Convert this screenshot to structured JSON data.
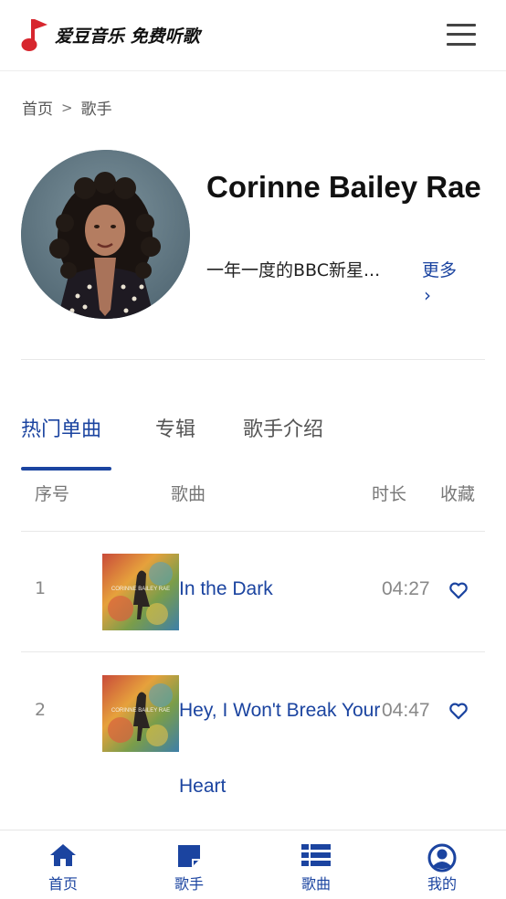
{
  "header": {
    "logo_text": "爱豆音乐 免费听歌",
    "menu_icon": "hamburger-menu-icon"
  },
  "breadcrumb": {
    "home": "首页",
    "current": "歌手"
  },
  "artist": {
    "name": "Corinne Bailey Rae",
    "description": "一年一度的BBC新星...",
    "more_label": "更多",
    "more_chevron": "›"
  },
  "tabs": [
    {
      "label": "热门单曲",
      "active": true
    },
    {
      "label": "专辑",
      "active": false
    },
    {
      "label": "歌手介绍",
      "active": false
    }
  ],
  "table": {
    "headers": {
      "index": "序号",
      "song": "歌曲",
      "duration": "时长",
      "favorite": "收藏"
    },
    "rows": [
      {
        "index": "1",
        "title": "In the Dark",
        "title_line2": "",
        "duration": "04:27",
        "favorite_icon": "heart-outline-icon"
      },
      {
        "index": "2",
        "title": "Hey, I Won't Break Your",
        "title_line2": "Heart",
        "duration": "04:47",
        "favorite_icon": "heart-outline-icon"
      }
    ],
    "cover_text": "CORINNE BAILEY RAE"
  },
  "bottom_nav": [
    {
      "label": "首页",
      "icon": "home-icon"
    },
    {
      "label": "歌手",
      "icon": "singer-note-icon"
    },
    {
      "label": "歌曲",
      "icon": "list-icon"
    },
    {
      "label": "我的",
      "icon": "user-circle-icon"
    }
  ],
  "colors": {
    "accent": "#1b44a0",
    "logo_red": "#d7262e",
    "text_muted": "#888888"
  }
}
